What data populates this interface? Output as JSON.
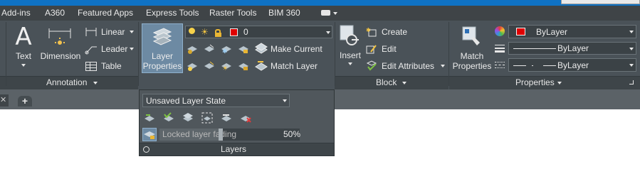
{
  "menu_tabs": [
    "Add-ins",
    "A360",
    "Featured Apps",
    "Express Tools",
    "Raster Tools",
    "BIM 360"
  ],
  "annotation": {
    "text_label": "Text",
    "dimension_label": "Dimension",
    "linear_label": "Linear",
    "leader_label": "Leader",
    "table_label": "Table",
    "panel_title": "Annotation"
  },
  "layers": {
    "layer_properties_label_1": "Layer",
    "layer_properties_label_2": "Properties",
    "current_layer": "0",
    "make_current_label": "Make Current",
    "match_layer_label": "Match Layer",
    "layer_state": "Unsaved Layer State",
    "fading_label": "Locked layer fading",
    "fading_value": "50%",
    "fading_fraction": 0.5,
    "panel_title": "Layers"
  },
  "block": {
    "insert_label": "Insert",
    "create_label": "Create",
    "edit_label": "Edit",
    "edit_attributes_label": "Edit Attributes",
    "panel_title": "Block"
  },
  "properties": {
    "match_properties_label_1": "Match",
    "match_properties_label_2": "Properties",
    "color_value": "ByLayer",
    "lineweight_value": "ByLayer",
    "linetype_value": "ByLayer",
    "panel_title": "Properties"
  },
  "file_tabs": {
    "new_tab_symbol": "+"
  },
  "colors": {
    "accent_blue": "#0f72c4",
    "ribbon_bg": "#4a5258",
    "layer_swatch": "#e00000",
    "color_swatch": "#e00000"
  }
}
